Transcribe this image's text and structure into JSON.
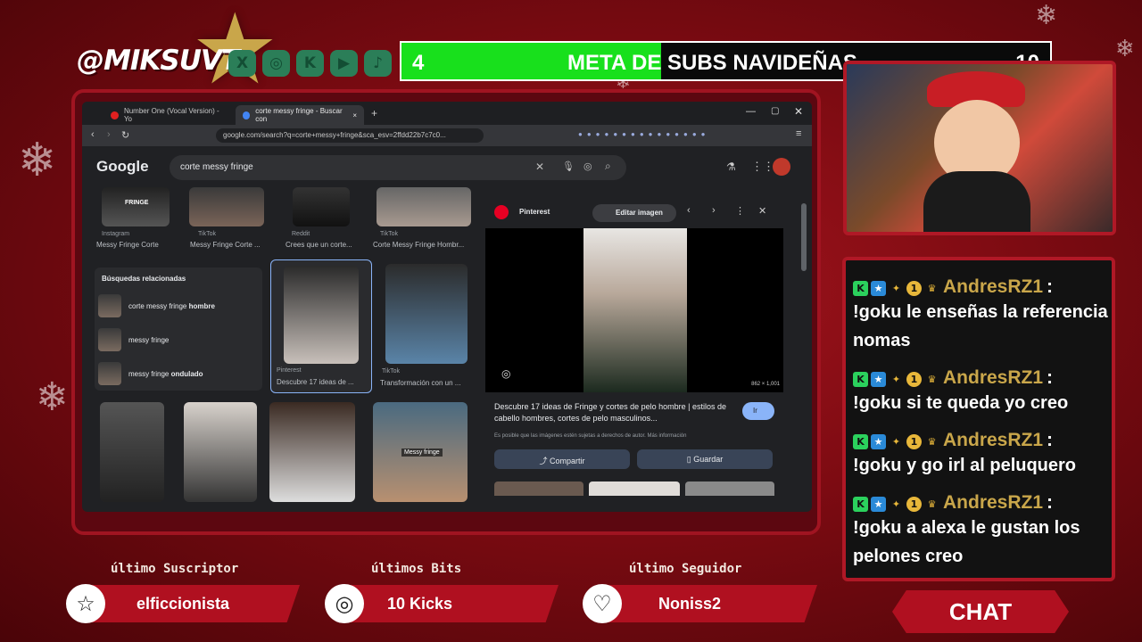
{
  "overlay": {
    "handle": "@MIKSUVT",
    "social_icons": [
      "x-icon",
      "instagram-icon",
      "kick-icon",
      "youtube-icon",
      "tiktok-icon"
    ],
    "goal": {
      "current": "4",
      "title": "META DE SUBS NAVIDEÑAS",
      "target": "10",
      "progress": 0.4,
      "fill_color": "#18e01c"
    },
    "last_subscriber": {
      "label": "último Suscriptor",
      "value": "elficcionista",
      "icon": "star-icon"
    },
    "last_bits": {
      "label": "últimos Bits",
      "value": "10 Kicks",
      "icon": "kick-coin-icon"
    },
    "last_follower": {
      "label": "último Seguidor",
      "value": "Noniss2",
      "icon": "heart-icon"
    },
    "chat_button": "CHAT",
    "accent_color": "#b01020"
  },
  "chat": {
    "messages": [
      {
        "user": "AndresRZ1",
        "sep": ":",
        "text": "!goku le enseñas la referencia nomas"
      },
      {
        "user": "AndresRZ1",
        "sep": ":",
        "text": "!goku si te queda yo creo"
      },
      {
        "user": "AndresRZ1",
        "sep": ":",
        "text": "!goku y go irl al peluquero"
      },
      {
        "user": "AndresRZ1",
        "sep": ":",
        "text": "!goku a alexa le gustan los pelones creo"
      }
    ]
  },
  "browser": {
    "tabs": [
      {
        "title": "Number One (Vocal Version) - Yo"
      },
      {
        "title": "corte messy fringe - Buscar con"
      }
    ],
    "url": "google.com/search?q=corte+messy+fringe&sca_esv=2ffdd22b7c7c0...",
    "logo": "Google",
    "query": "corte messy fringe",
    "top_results": [
      {
        "source": "Instagram",
        "caption": "Messy Fringe Corte"
      },
      {
        "source": "TikTok",
        "caption": "Messy Fringe Corte ..."
      },
      {
        "source": "Reddit",
        "caption": "Crees que un corte..."
      },
      {
        "source": "TikTok",
        "caption": "Corte Messy Fringe Hombr..."
      }
    ],
    "thumb_overlay_1": "FRINGE",
    "related": {
      "title": "Búsquedas relacionadas",
      "items": [
        {
          "prefix": "corte messy fringe ",
          "bold": "hombre"
        },
        {
          "prefix": "messy fringe",
          "bold": ""
        },
        {
          "prefix": "messy fringe ",
          "bold": "ondulado"
        }
      ]
    },
    "mid_results": [
      {
        "source": "Pinterest",
        "caption": "Descubre 17 ideas de ..."
      },
      {
        "source": "TikTok",
        "caption": "Transformación con un ..."
      }
    ],
    "grid_overlay": "Messy fringe",
    "preview": {
      "source": "Pinterest",
      "edit_button": "Editar imagen",
      "dimensions": "862 × 1,001",
      "title": "Descubre 17 ideas de Fringe y cortes de pelo hombre | estilos de cabello hombres, cortes de pelo masculinos...",
      "go_button": "Ir",
      "note": "Es posible que las imágenes estén sujetas a derechos de autor. Más información",
      "share_button": "Compartir",
      "save_button": "Guardar"
    }
  }
}
